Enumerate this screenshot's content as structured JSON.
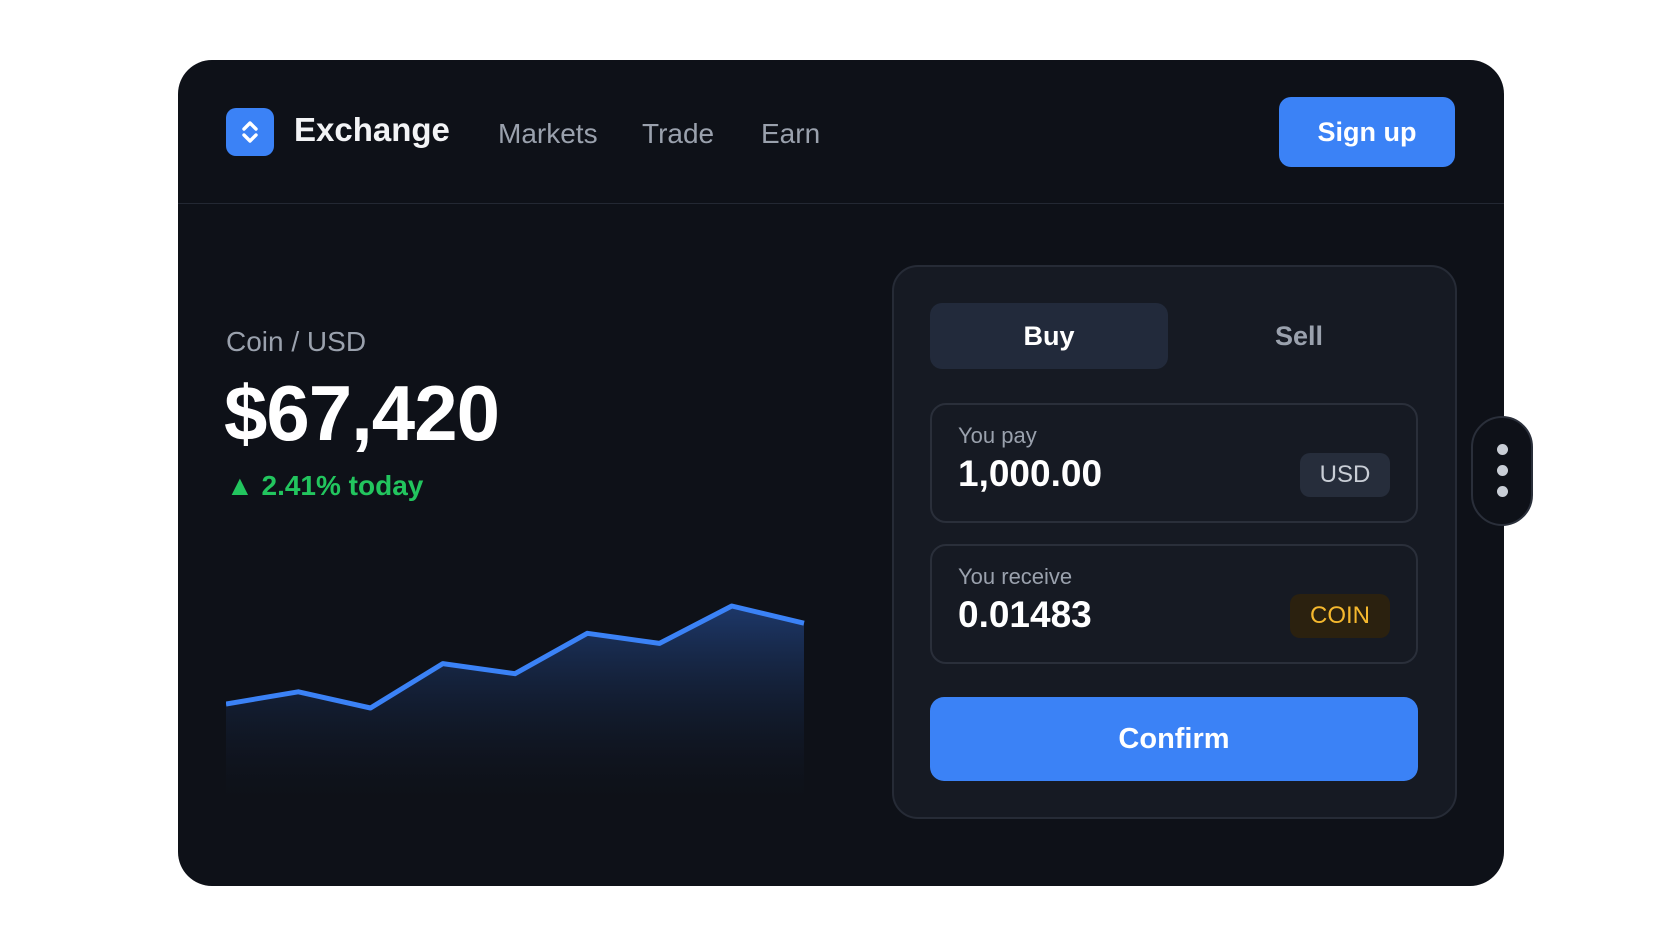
{
  "header": {
    "brand": "Exchange",
    "nav": [
      "Markets",
      "Trade",
      "Earn"
    ],
    "signup_label": "Sign up"
  },
  "market": {
    "pair": "Coin / USD",
    "price": "$67,420",
    "change": "▲ 2.41% today"
  },
  "chart_data": {
    "type": "area",
    "x": [
      1,
      2,
      3,
      4,
      5,
      6,
      7,
      8,
      9
    ],
    "values": [
      0,
      12,
      -4,
      40,
      30,
      70,
      60,
      97,
      80
    ],
    "line_color": "#3b82f6",
    "fill_color": "#1e3a6e"
  },
  "trade": {
    "tabs": [
      {
        "label": "Buy",
        "active": true
      },
      {
        "label": "Sell",
        "active": false
      }
    ],
    "pay": {
      "label": "You pay",
      "value": "1,000.00",
      "currency": "USD"
    },
    "receive": {
      "label": "You receive",
      "value": "0.01483",
      "currency": "COIN"
    },
    "confirm_label": "Confirm"
  },
  "side_menu": {
    "icon": "more-vertical-icon"
  },
  "colors": {
    "accent": "#3b82f6",
    "positive": "#22c55e",
    "coin": "#f5b82e",
    "background": "#0e1118"
  }
}
